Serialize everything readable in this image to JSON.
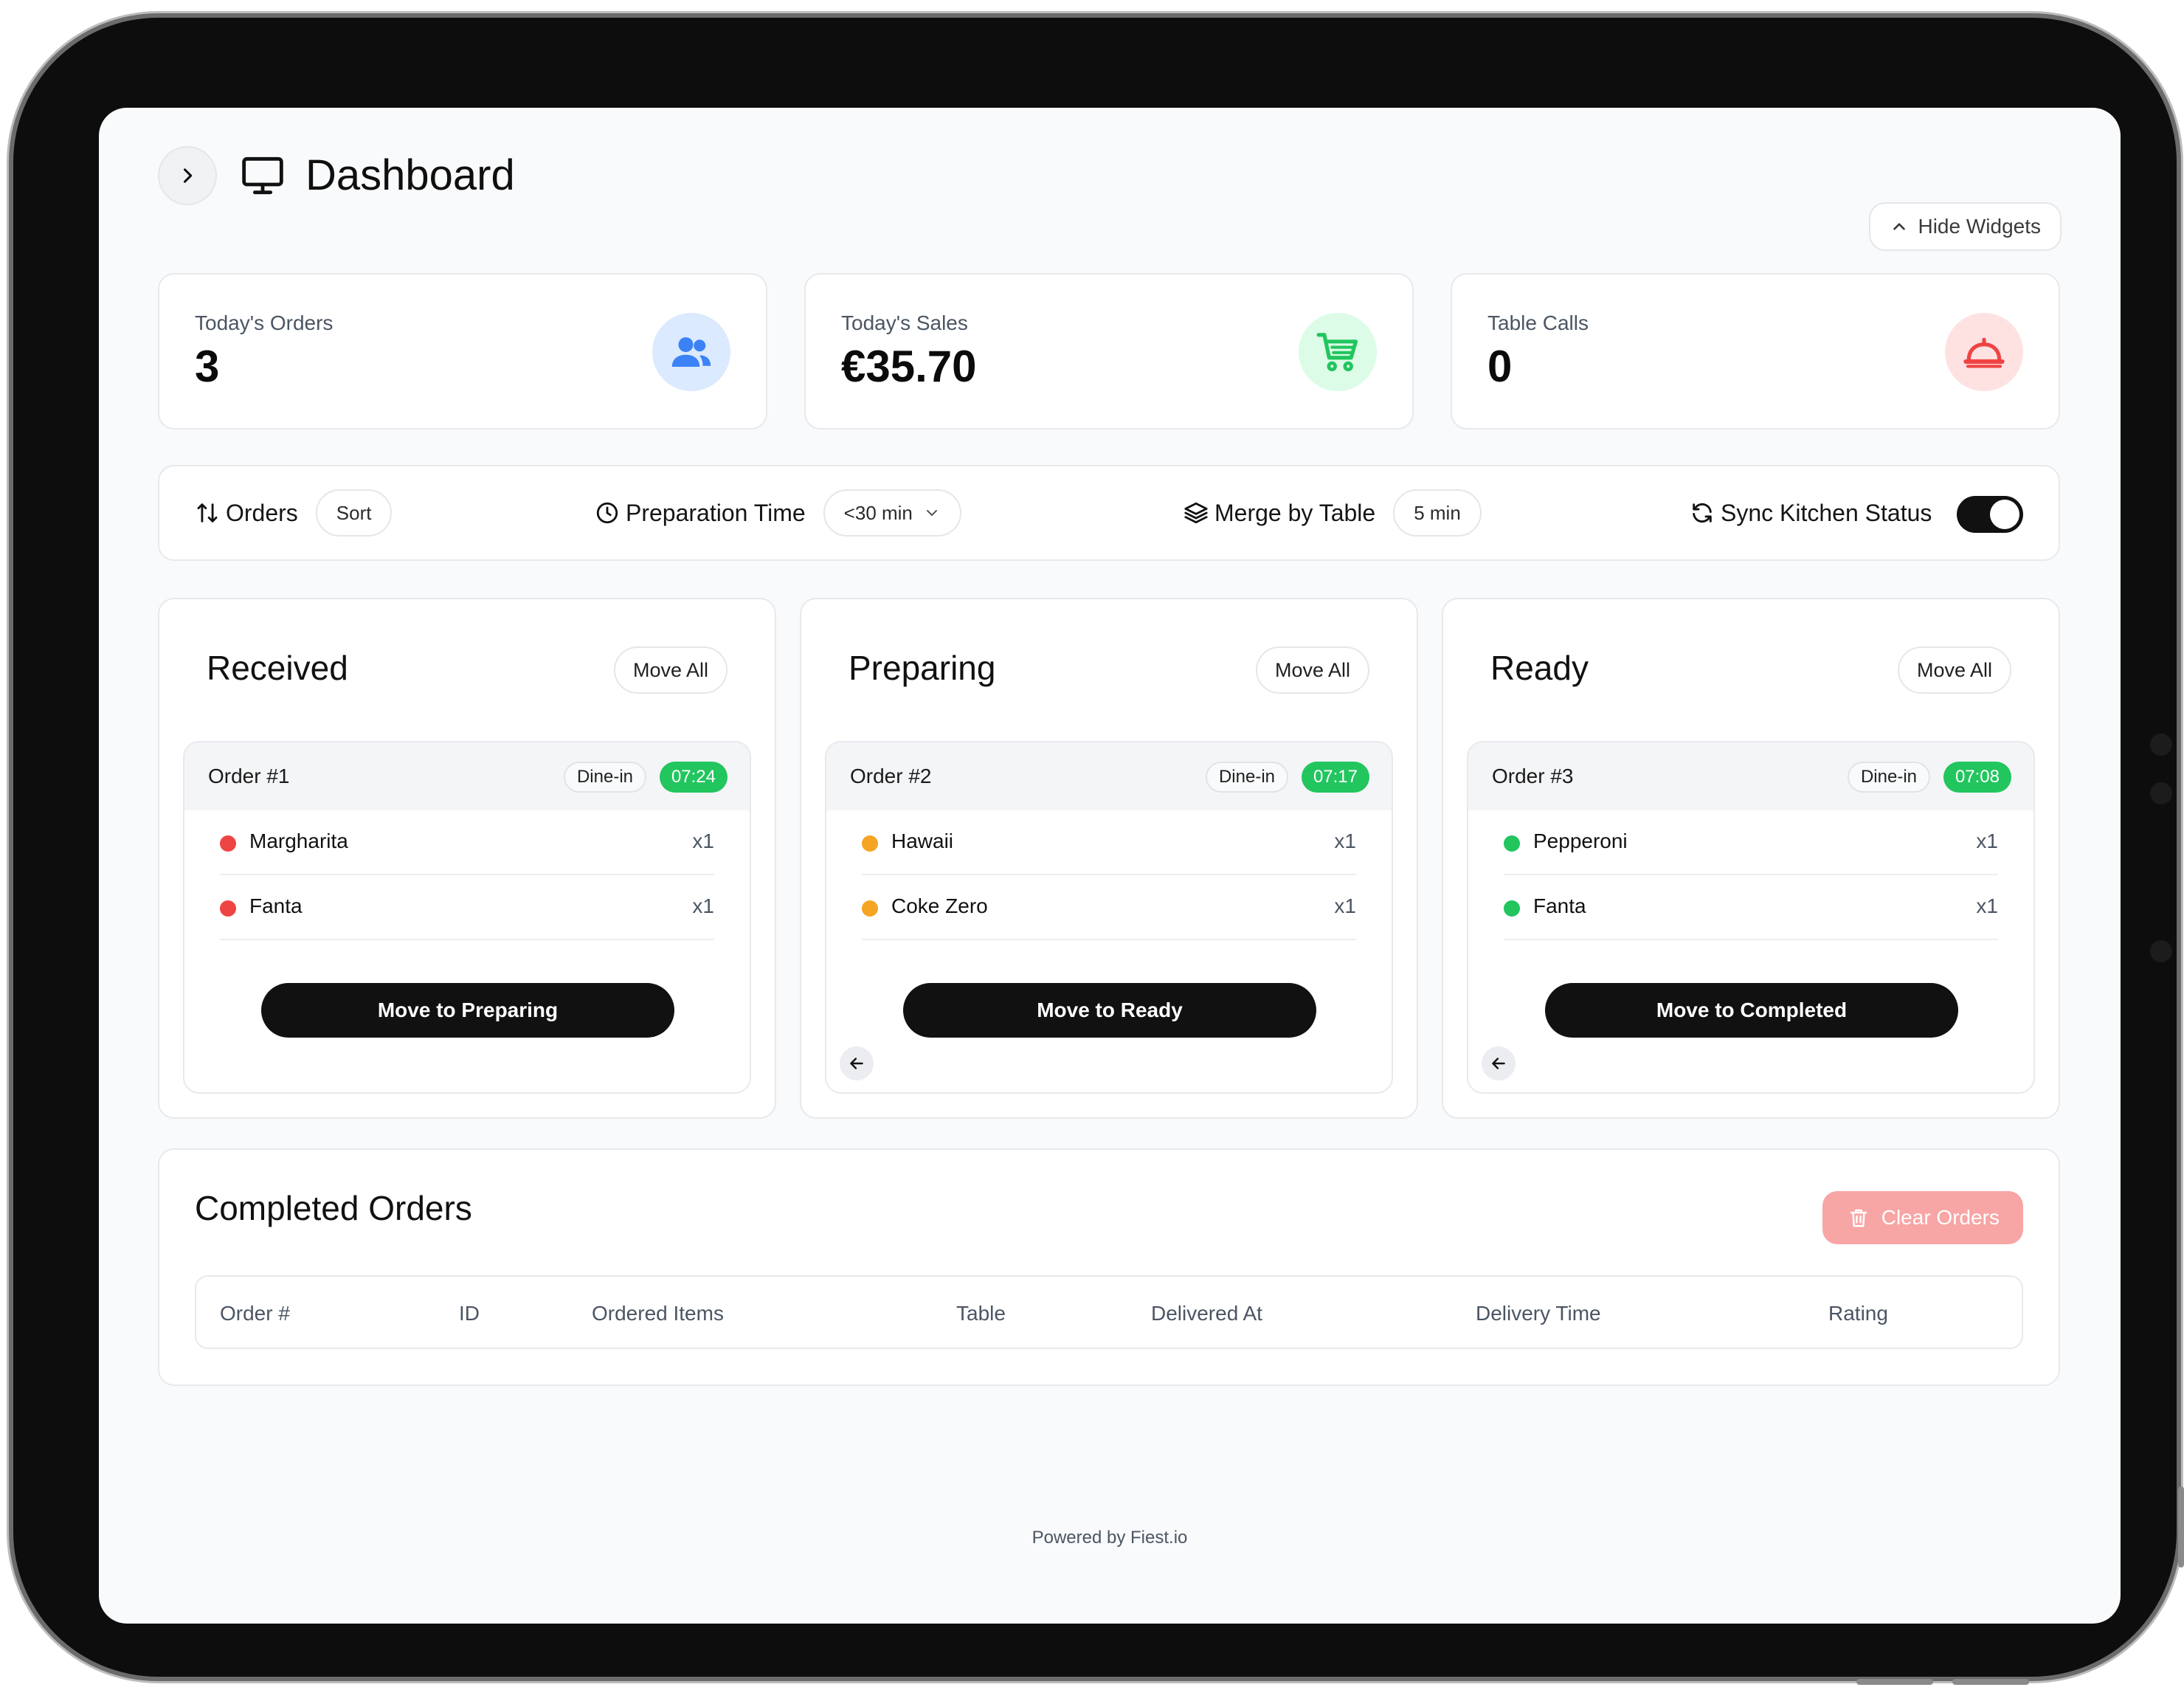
{
  "header": {
    "title": "Dashboard",
    "hide_widgets_label": "Hide Widgets"
  },
  "stats": [
    {
      "label": "Today's Orders",
      "value": "3",
      "icon": "users-icon",
      "icon_bg": "#dbeafe",
      "icon_color": "#3b82f6"
    },
    {
      "label": "Today's Sales",
      "value": "€35.70",
      "icon": "cart-icon",
      "icon_bg": "#dcfce7",
      "icon_color": "#22c55e"
    },
    {
      "label": "Table Calls",
      "value": "0",
      "icon": "cloche-icon",
      "icon_bg": "#fee2e2",
      "icon_color": "#ef4444"
    }
  ],
  "toolbar": {
    "orders_label": "Orders",
    "sort_label": "Sort",
    "prep_time_label": "Preparation Time",
    "prep_time_value": "<30 min",
    "merge_label": "Merge by Table",
    "merge_value": "5 min",
    "sync_label": "Sync Kitchen Status",
    "sync_on": true
  },
  "columns": [
    {
      "title": "Received",
      "move_all_label": "Move All",
      "order": {
        "title": "Order #1",
        "type": "Dine-in",
        "time": "07:24",
        "items": [
          {
            "name": "Margharita",
            "qty": "x1"
          },
          {
            "name": "Fanta",
            "qty": "x1"
          }
        ],
        "dot_color": "#ef4444",
        "action_label": "Move to Preparing",
        "has_back": false
      }
    },
    {
      "title": "Preparing",
      "move_all_label": "Move All",
      "order": {
        "title": "Order #2",
        "type": "Dine-in",
        "time": "07:17",
        "items": [
          {
            "name": "Hawaii",
            "qty": "x1"
          },
          {
            "name": "Coke Zero",
            "qty": "x1"
          }
        ],
        "dot_color": "#f5a524",
        "action_label": "Move to Ready",
        "has_back": true
      }
    },
    {
      "title": "Ready",
      "move_all_label": "Move All",
      "order": {
        "title": "Order #3",
        "type": "Dine-in",
        "time": "07:08",
        "items": [
          {
            "name": "Pepperoni",
            "qty": "x1"
          },
          {
            "name": "Fanta",
            "qty": "x1"
          }
        ],
        "dot_color": "#22c55e",
        "action_label": "Move to Completed",
        "has_back": true
      }
    }
  ],
  "completed": {
    "title": "Completed Orders",
    "clear_label": "Clear Orders",
    "columns": [
      "Order #",
      "ID",
      "Ordered Items",
      "Table",
      "Delivered At",
      "Delivery Time",
      "Rating"
    ]
  },
  "footer": {
    "text": "Powered by Fiest.io"
  },
  "colors": {
    "badge_green": "#22c55e",
    "clear_button": "#f8a5a5"
  }
}
